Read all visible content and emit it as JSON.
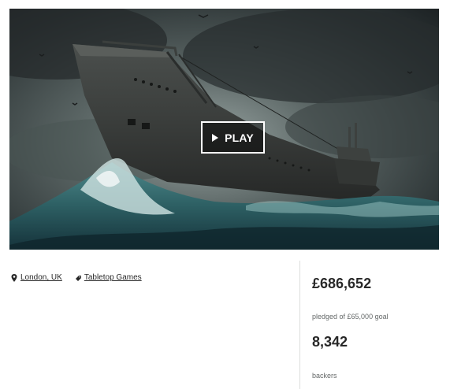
{
  "video": {
    "play_label": "PLAY",
    "thumbnail_icon": "submarine-in-storm-image"
  },
  "meta": {
    "location": "London, UK",
    "category": "Tabletop Games",
    "location_icon": "map-pin-icon",
    "category_icon": "tag-icon"
  },
  "stats": {
    "pledged": "£686,652",
    "pledged_caption": "pledged of £65,000 goal",
    "backers": "8,342",
    "backers_caption": "backers"
  },
  "colors": {
    "text": "#282828",
    "muted": "#656969",
    "divider": "#dcdedd"
  }
}
